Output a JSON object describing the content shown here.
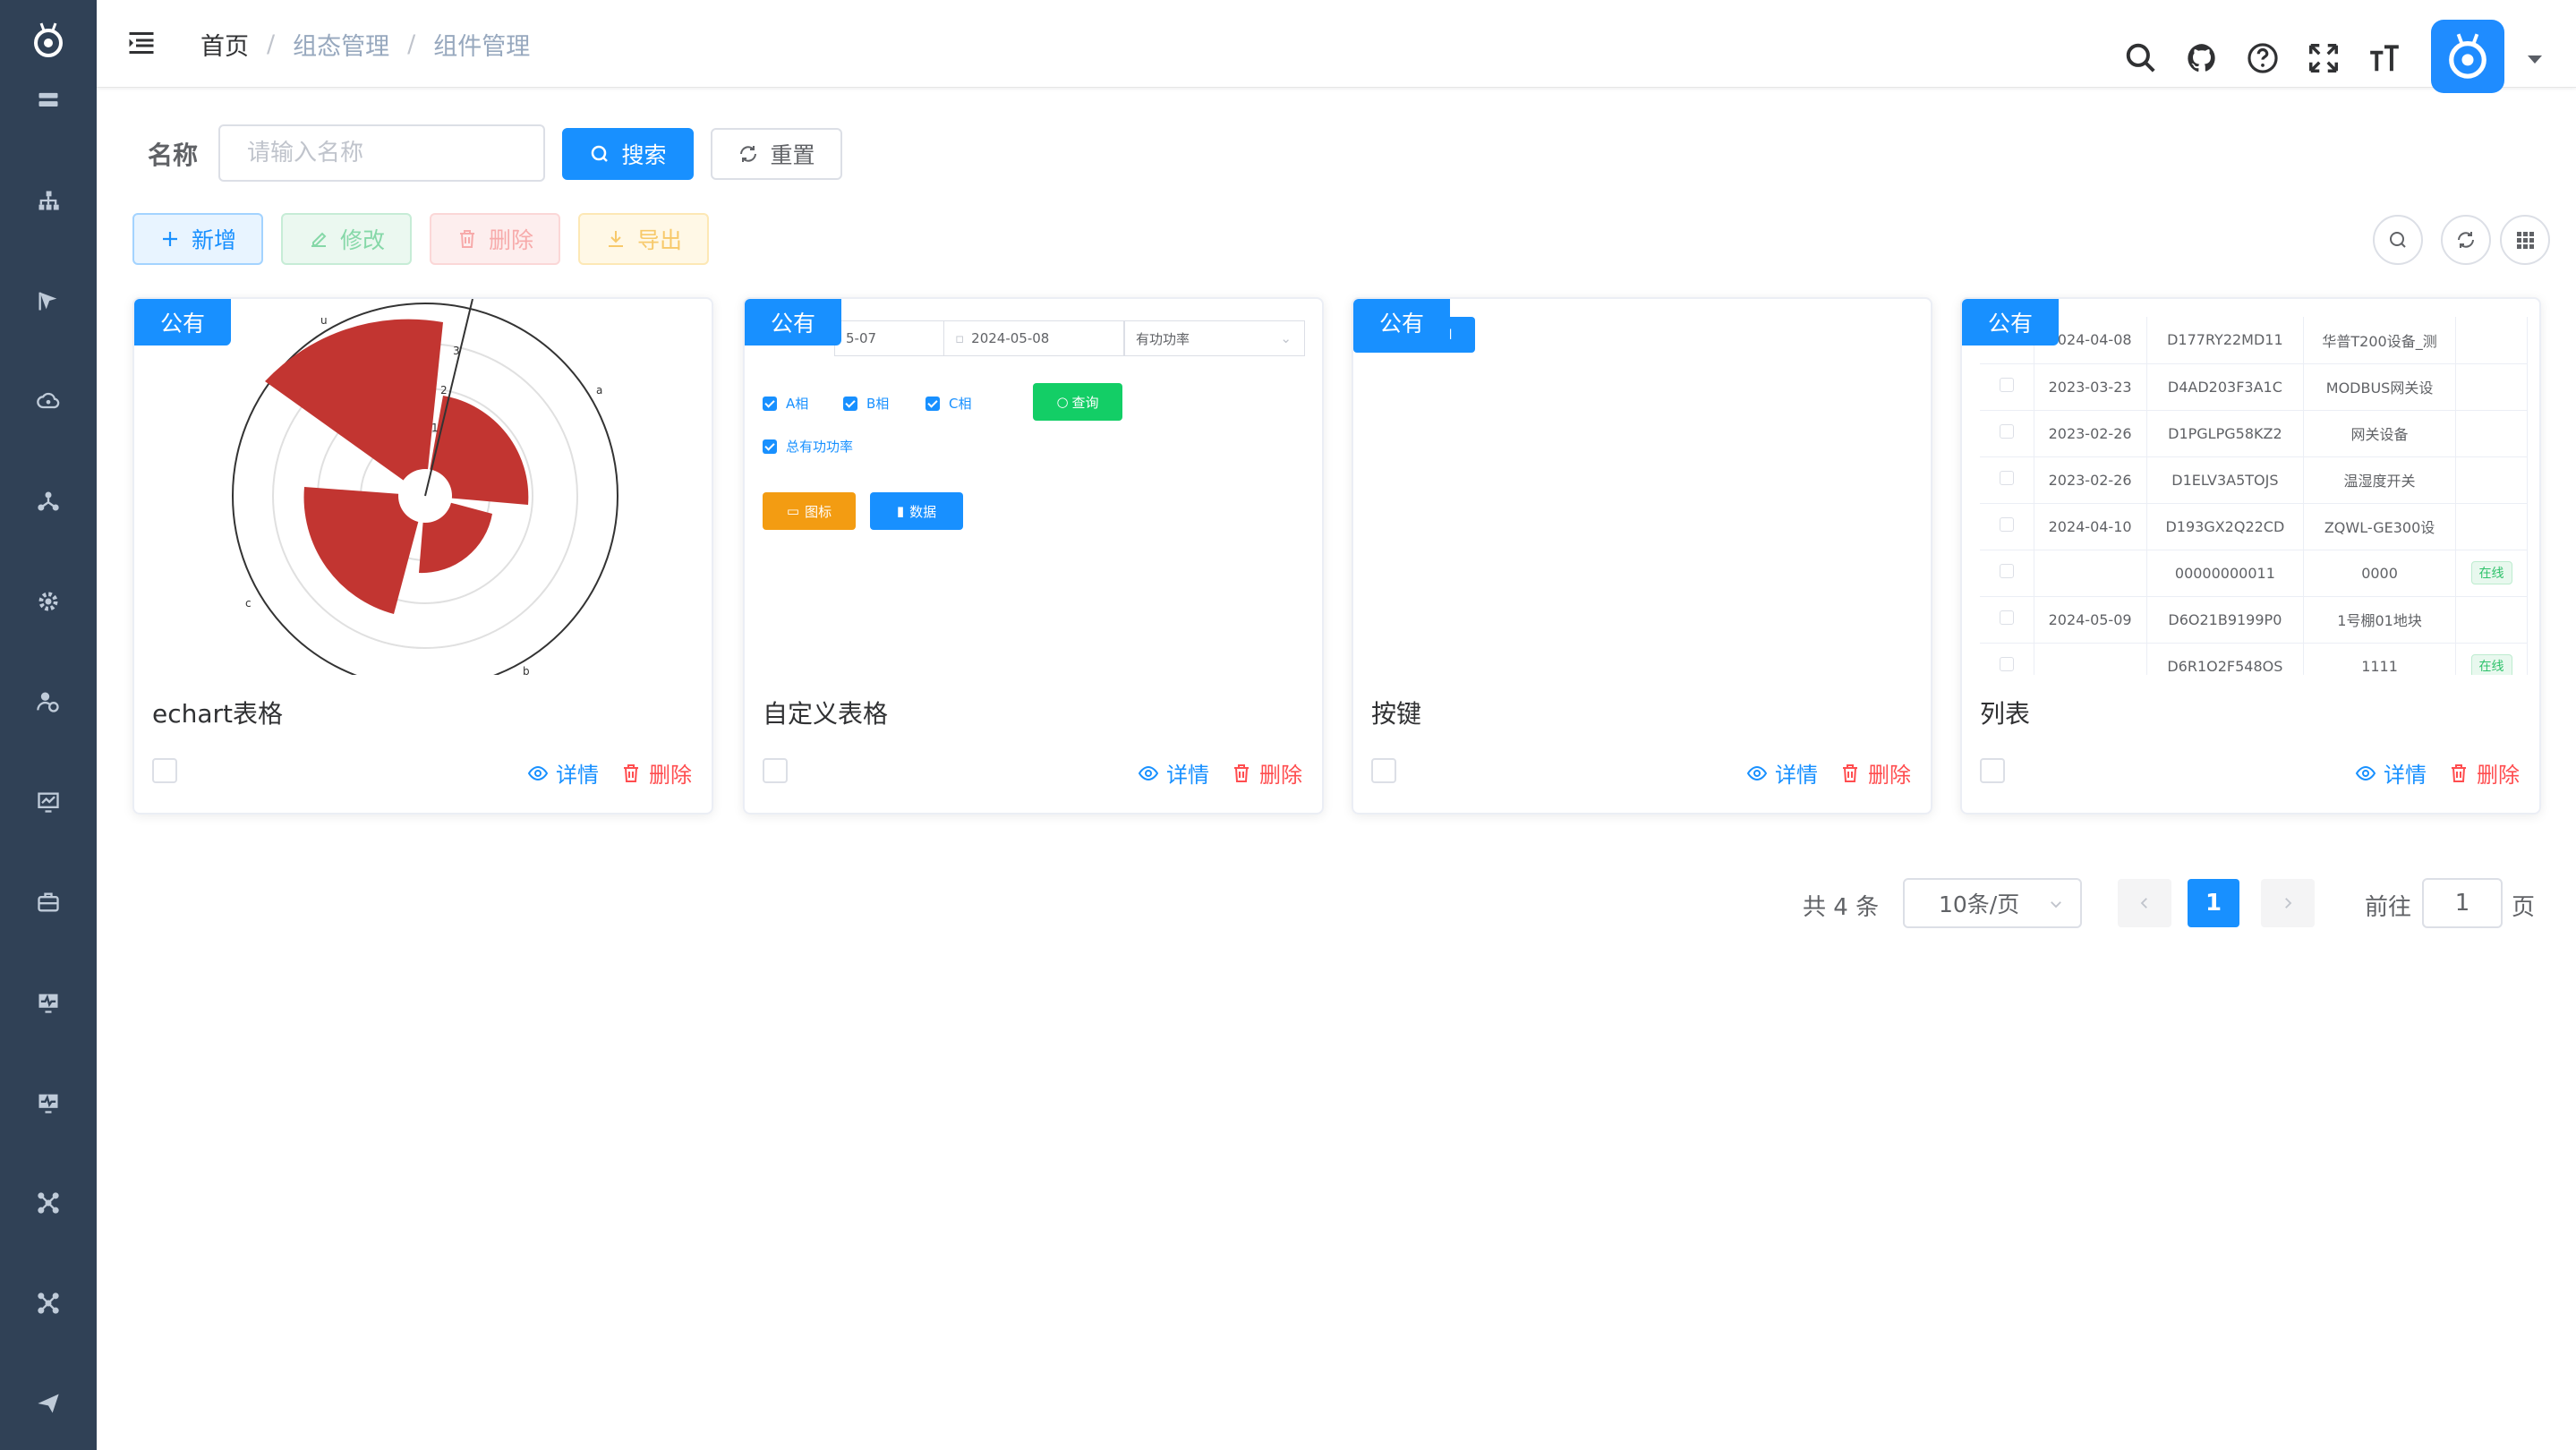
{
  "breadcrumb": {
    "home": "首页",
    "section": "组态管理",
    "current": "组件管理"
  },
  "header_icons": [
    "search-icon",
    "github-icon",
    "help-icon",
    "fullscreen-icon",
    "font-size-icon"
  ],
  "sidebar_icons": [
    "server-icon",
    "org-tree-icon",
    "flag-icon",
    "cloud-icon",
    "network-icon",
    "gear-icon",
    "user-settings-icon",
    "monitor-chart-icon",
    "briefcase-icon",
    "monitor-pulse-icon",
    "monitor-pulse-icon",
    "scene-icon",
    "scene-icon",
    "send-icon"
  ],
  "search": {
    "label": "名称",
    "placeholder": "请输入名称",
    "search_label": "搜索",
    "reset_label": "重置"
  },
  "toolbar": {
    "add_label": "新增",
    "edit_label": "修改",
    "delete_label": "删除",
    "export_label": "导出"
  },
  "cards": [
    {
      "badge": "公有",
      "title": "echart表格",
      "detail_label": "详情",
      "delete_label": "删除"
    },
    {
      "badge": "公有",
      "title": "自定义表格",
      "detail_label": "详情",
      "delete_label": "删除"
    },
    {
      "badge": "公有",
      "title": "按键",
      "detail_label": "详情",
      "delete_label": "删除"
    },
    {
      "badge": "公有",
      "title": "列表",
      "detail_label": "详情",
      "delete_label": "删除"
    }
  ],
  "preview_polar": {
    "axis_labels": [
      "u",
      "a",
      "b",
      "c"
    ],
    "ticks": [
      "1",
      "2",
      "3"
    ],
    "color": "#c23531"
  },
  "preview_form": {
    "date_start": "5-07",
    "date_end": "2024-05-08",
    "select_value": "有功功率",
    "checks": [
      "A相",
      "B相",
      "C相",
      "总有功功率"
    ],
    "query_label": "查询",
    "chart_btn": "图标",
    "data_btn": "数据"
  },
  "preview_table": [
    {
      "date": "2024-04-08",
      "serial": "D177RY22MD11",
      "name": "华普T200设备_测",
      "status": ""
    },
    {
      "date": "2023-03-23",
      "serial": "D4AD203F3A1C",
      "name": "MODBUS网关设",
      "status": ""
    },
    {
      "date": "2023-02-26",
      "serial": "D1PGLPG58KZ2",
      "name": "网关设备",
      "status": ""
    },
    {
      "date": "2023-02-26",
      "serial": "D1ELV3A5TOJS",
      "name": "温湿度开关",
      "status": ""
    },
    {
      "date": "2024-04-10",
      "serial": "D193GX2Q22CD",
      "name": "ZQWL-GE300设",
      "status": ""
    },
    {
      "date": "",
      "serial": "00000000011",
      "name": "0000",
      "status": "在线"
    },
    {
      "date": "2024-05-09",
      "serial": "D6O21B9199P0",
      "name": "1号棚01地块",
      "status": ""
    },
    {
      "date": "",
      "serial": "D6R1O2F548OS",
      "name": "1111",
      "status": "在线"
    }
  ],
  "pagination": {
    "total_text": "共 4 条",
    "page_size": "10条/页",
    "current_page": "1",
    "goto_label": "前往",
    "goto_value": "1",
    "page_suffix": "页"
  },
  "colors": {
    "primary": "#1890ff",
    "sidebar": "#304156",
    "danger": "#ff4d4f",
    "success": "#13ce66",
    "warning": "#f39c12"
  }
}
